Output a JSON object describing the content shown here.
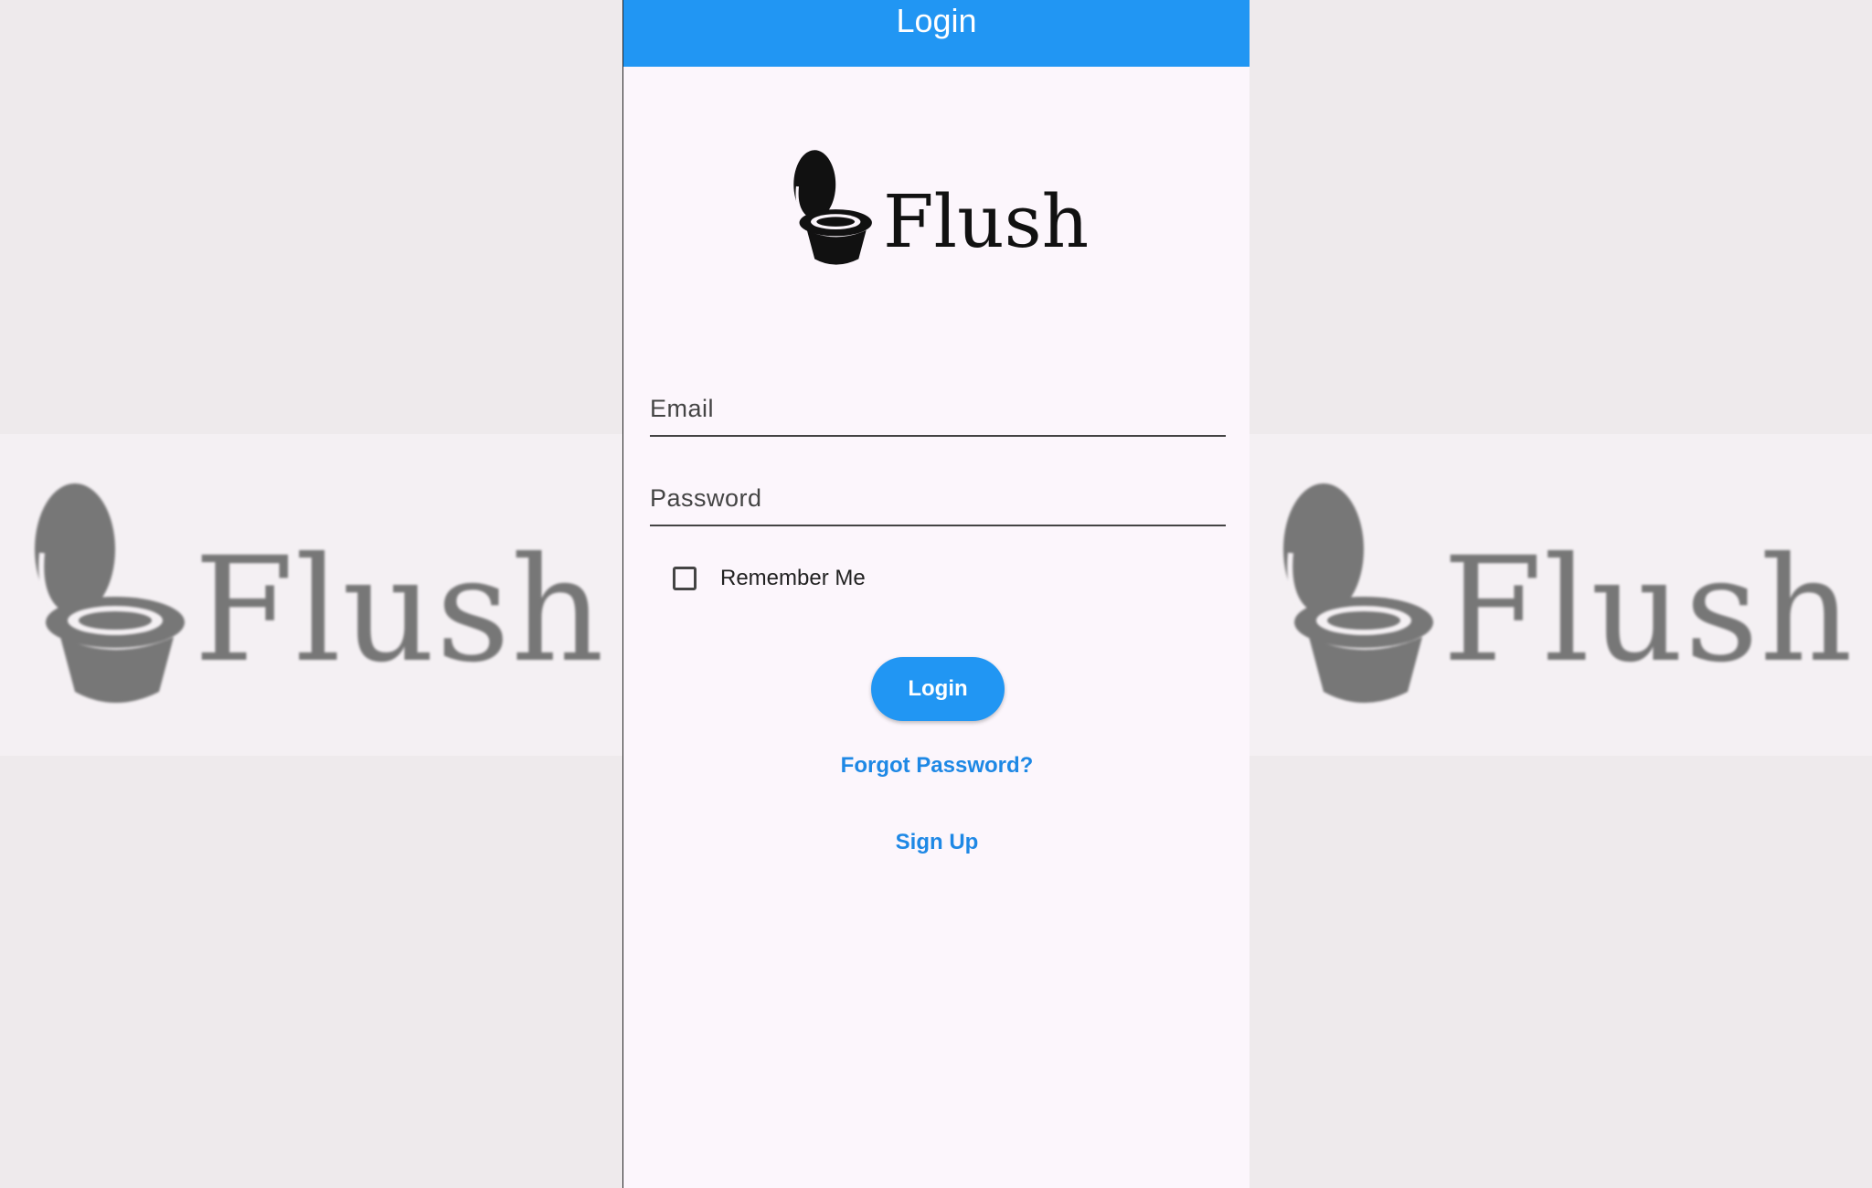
{
  "app_bar": {
    "title": "Login"
  },
  "logo": {
    "text": "Flush",
    "icon": "toilet-icon"
  },
  "background": {
    "logo_text": "Flush"
  },
  "form": {
    "email_placeholder": "Email",
    "email_value": "",
    "password_placeholder": "Password",
    "password_value": "",
    "remember_label": "Remember Me",
    "remember_checked": false,
    "login_label": "Login",
    "forgot_label": "Forgot Password?",
    "signup_label": "Sign Up"
  },
  "colors": {
    "primary": "#2196f3",
    "link": "#1e88e5",
    "surface": "#fcf6fc",
    "backdrop": "#eeeaec"
  }
}
